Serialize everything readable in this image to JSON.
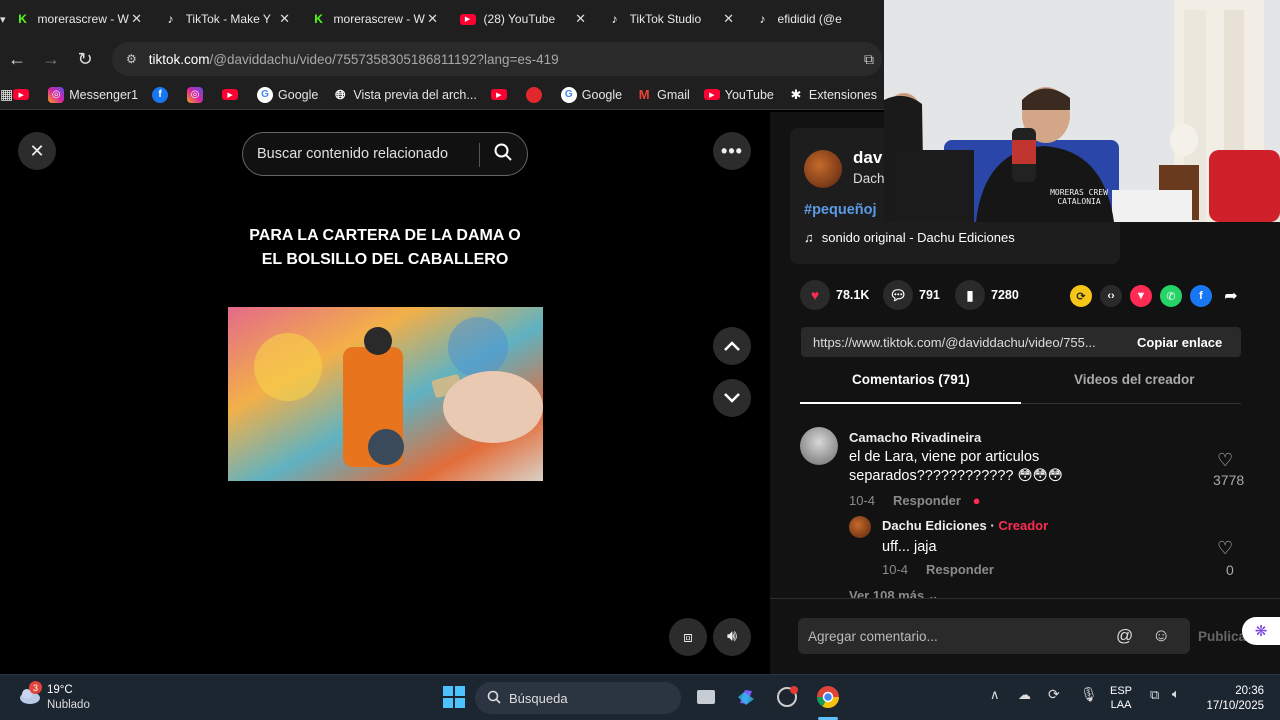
{
  "browser": {
    "tabs": [
      {
        "title": "morerascrew - W",
        "icon": "kick-icon",
        "color": "#53fc18"
      },
      {
        "title": "TikTok - Make Y",
        "icon": "tiktok-icon",
        "color": "#ffffff"
      },
      {
        "title": "morerascrew - W",
        "icon": "kick-icon",
        "color": "#53fc18"
      },
      {
        "title": "(28) YouTube",
        "icon": "youtube-icon",
        "color": "#ff0033"
      },
      {
        "title": "TikTok Studio",
        "icon": "tiktok-icon",
        "color": "#ffffff"
      },
      {
        "title": "efididid (@e",
        "icon": "tiktok-icon",
        "color": "#ffffff"
      }
    ],
    "url_domain": "tiktok.com",
    "url_path": "/@daviddachu/video/7557358305186811192?lang=es-419",
    "bookmarks": [
      {
        "label": "",
        "icon": "youtube-icon",
        "color": "#ff0033"
      },
      {
        "label": "Messenger1",
        "icon": "instagram-icon",
        "color": "#d6249f"
      },
      {
        "label": "",
        "icon": "facebook-icon",
        "color": "#1877f2"
      },
      {
        "label": "",
        "icon": "instagram-icon",
        "color": "#d6249f"
      },
      {
        "label": "",
        "icon": "youtube-icon",
        "color": "#ff0033"
      },
      {
        "label": "Google",
        "icon": "google-icon",
        "color": "#ffffff"
      },
      {
        "label": "Vista previa del arch...",
        "icon": "globe-icon",
        "color": "#ffffff"
      },
      {
        "label": "",
        "icon": "youtube-icon",
        "color": "#ff0033"
      },
      {
        "label": "",
        "icon": "app-icon",
        "color": "#e0282e"
      },
      {
        "label": "Google",
        "icon": "google-icon",
        "color": "#ffffff"
      },
      {
        "label": "Gmail",
        "icon": "gmail-icon",
        "color": "#ea4335"
      },
      {
        "label": "YouTube",
        "icon": "youtube-icon",
        "color": "#ff0033"
      },
      {
        "label": "Extensiones",
        "icon": "puzzle-icon",
        "color": "#ffffff"
      }
    ]
  },
  "player": {
    "search_placeholder": "Buscar contenido relacionado",
    "caption": "PARA LA CARTERA DE LA DAMA O EL BOLSILLO DEL CABALLERO"
  },
  "video_info": {
    "author_handle": "dav",
    "author_name": "Dach",
    "hashtag": "#pequeñoj",
    "sound": "sonido original - Dachu Ediciones",
    "likes": "78.1K",
    "comments": "791",
    "saves": "7280",
    "link": "https://www.tiktok.com/@daviddachu/video/755...",
    "copy_label": "Copiar enlace",
    "tab_comments": "Comentarios (791)",
    "tab_creator_videos": "Videos del creador"
  },
  "comments": [
    {
      "name": "Camacho Rivadineira",
      "text": "el de Lara, viene por articulos separados???????????? 😳😳😳",
      "date": "10-4",
      "reply_label": "Responder",
      "likes": "3778"
    },
    {
      "name": "Dachu Ediciones",
      "badge": "Creador",
      "text": "uff... jaja",
      "date": "10-4",
      "reply_label": "Responder",
      "likes": "0"
    }
  ],
  "more_replies": "Ver 108 más",
  "comment_input": {
    "placeholder": "Agregar comentario...",
    "post_label": "Publicar"
  },
  "webcam": {
    "shirt_text": "MORERAS CREW CATALONIA"
  },
  "taskbar": {
    "temperature": "19°C",
    "weather": "Nublado",
    "weather_badge": "3",
    "search_label": "Búsqueda",
    "lang_top": "ESP",
    "lang_bottom": "LAA",
    "time": "20:36",
    "date": "17/10/2025"
  },
  "colors": {
    "accent_tiktok": "#fe2c55",
    "hashtag": "#5a9be6"
  }
}
